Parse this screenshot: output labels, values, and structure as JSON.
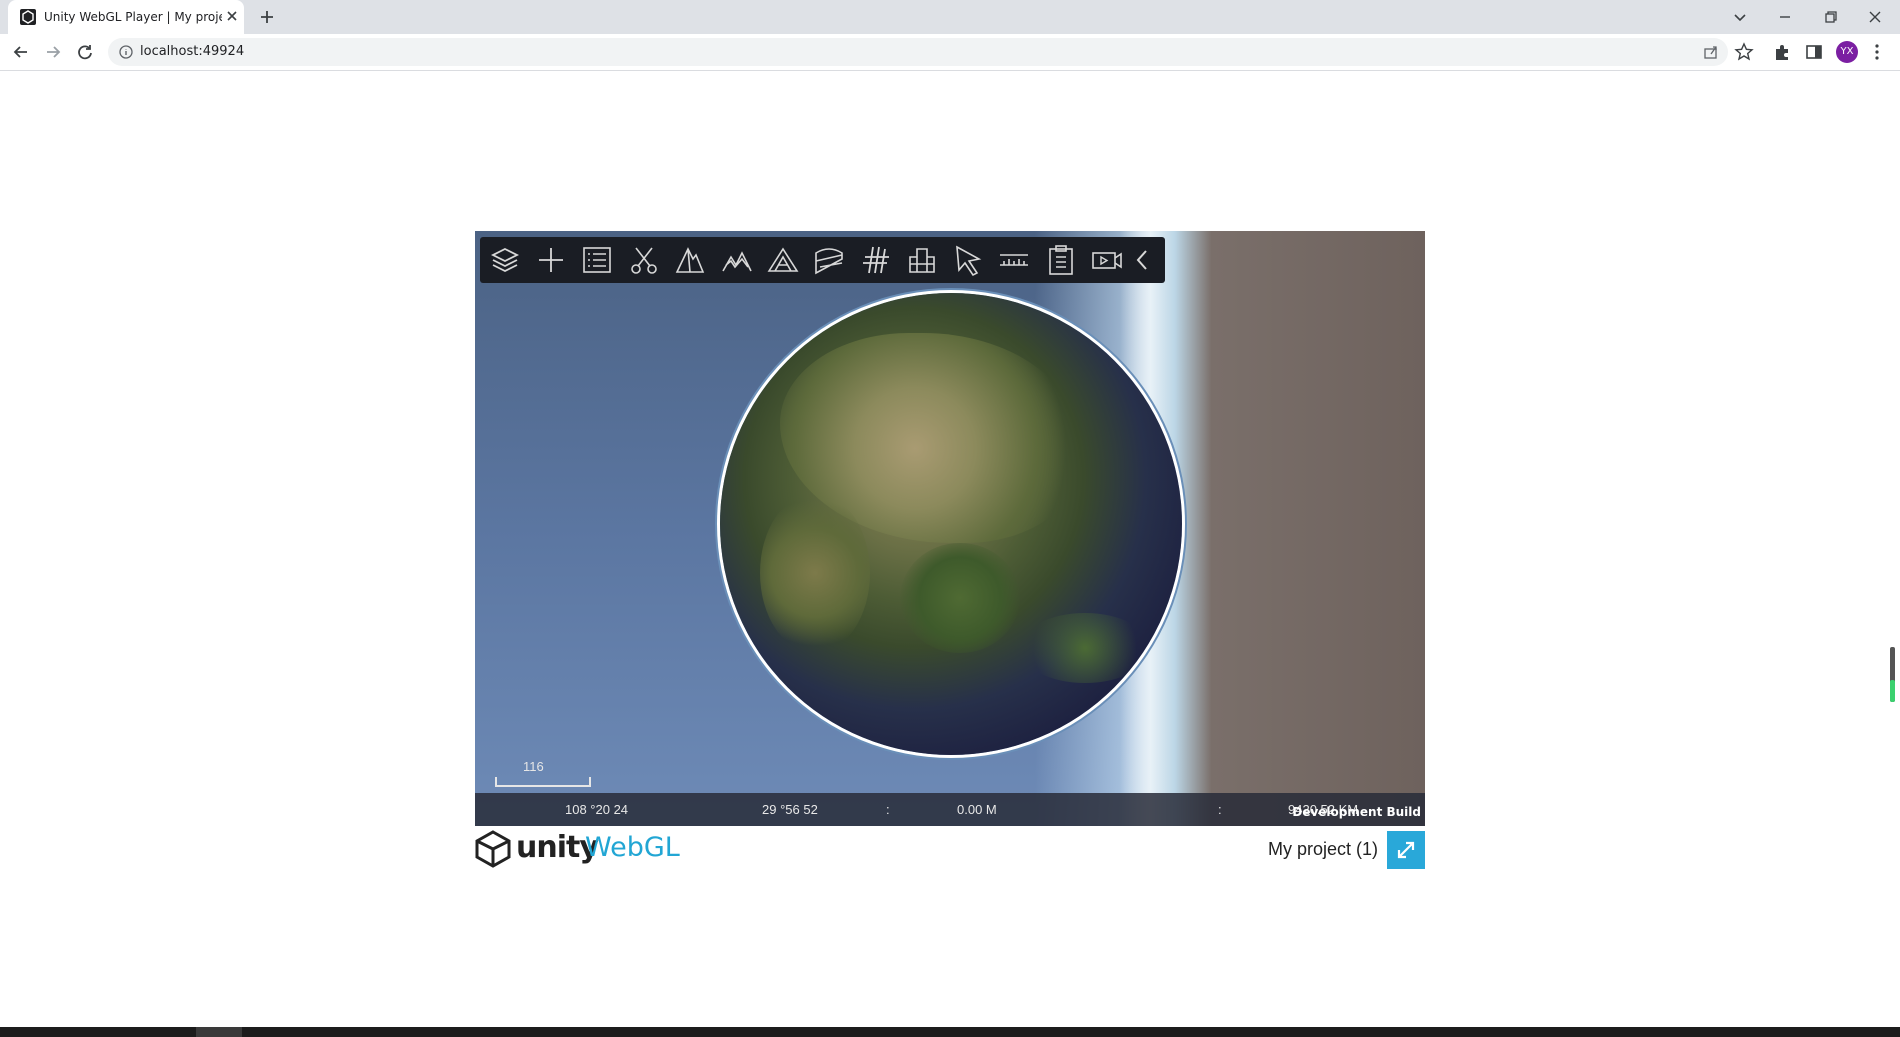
{
  "browser": {
    "tab_title": "Unity WebGL Player | My project (1)",
    "url": "localhost:49924",
    "avatar_initials": "YX"
  },
  "gis_toolbar": {
    "tools": [
      "layers-icon",
      "plus-icon",
      "list-icon",
      "scissors-icon",
      "mountain-outline-icon",
      "terrain-icon",
      "slope-icon",
      "profile-icon",
      "wind-icon",
      "building-icon",
      "cursor-icon",
      "ruler-icon",
      "clipboard-icon",
      "video-icon",
      "chevron-left-icon"
    ]
  },
  "scale": {
    "label": "116"
  },
  "status": {
    "longitude": "108 °20 24",
    "latitude": "29 °56 52",
    "sep1": ":",
    "elevation": "0.00 M",
    "sep2": ":",
    "distance": "9420.52 KM",
    "dev_build": "Development Build"
  },
  "footer": {
    "unity": "unity",
    "webgl": "WebGL",
    "project_name": "My project (1)"
  },
  "colors": {
    "accent": "#29a8d9",
    "toolbar_bg": "#1a1d24",
    "avatar": "#7b1fa2"
  }
}
